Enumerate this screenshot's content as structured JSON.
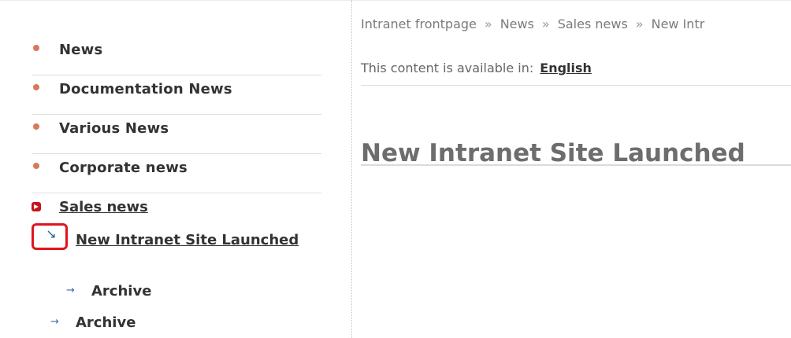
{
  "sidebar": {
    "items": [
      {
        "label": "News"
      },
      {
        "label": "Documentation News"
      },
      {
        "label": "Various News"
      },
      {
        "label": "Corporate news"
      }
    ],
    "active_section": {
      "label": "Sales news"
    },
    "current_page": {
      "label": "New Intranet Site Launched"
    },
    "sub_archive": {
      "label": "Archive"
    },
    "archive": {
      "label": "Archive"
    }
  },
  "breadcrumb": {
    "items": [
      "Intranet frontpage",
      "News",
      "Sales news",
      "New Intr"
    ],
    "separator": "»"
  },
  "content": {
    "available_text": "This content is available in:",
    "language": "English",
    "title": "New Intranet Site Launched"
  },
  "icons": {
    "bullet": "circle-bullet-icon",
    "active": "active-marker-icon",
    "current": "down-right-arrow-icon",
    "archive": "right-arrow-icon"
  },
  "colors": {
    "bullet": "#d9785a",
    "active_marker": "#c4161c",
    "highlight_box": "#e0141e",
    "icon_blue": "#1f5f99"
  }
}
